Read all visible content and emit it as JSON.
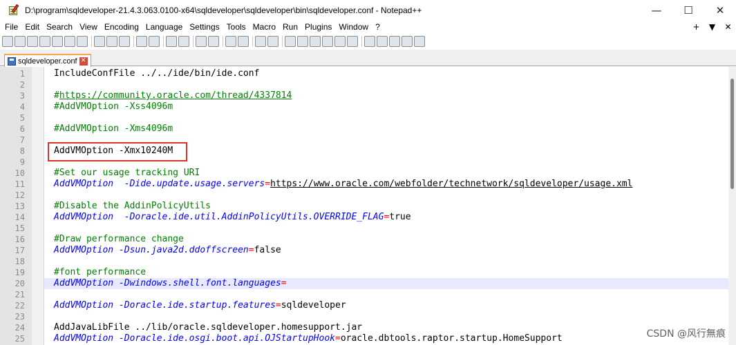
{
  "window": {
    "title": "D:\\program\\sqldeveloper-21.4.3.063.0100-x64\\sqldeveloper\\sqldeveloper\\bin\\sqldeveloper.conf - Notepad++",
    "minimize_glyph": "—",
    "maximize_glyph": "☐",
    "close_glyph": "✕"
  },
  "menu": {
    "items": [
      "File",
      "Edit",
      "Search",
      "View",
      "Encoding",
      "Language",
      "Settings",
      "Tools",
      "Macro",
      "Run",
      "Plugins",
      "Window",
      "?"
    ],
    "right": [
      "+",
      "▼",
      "✕"
    ]
  },
  "toolbar": {
    "buttons": [
      "new-file-icon",
      "open-file-icon",
      "save-icon",
      "save-all-icon",
      "close-icon",
      "close-all-icon",
      "print-icon",
      "|",
      "cut-icon",
      "copy-icon",
      "paste-icon",
      "|",
      "undo-icon",
      "redo-icon",
      "|",
      "find-icon",
      "replace-icon",
      "|",
      "zoom-in-icon",
      "zoom-out-icon",
      "|",
      "sync-vertical-icon",
      "sync-horizontal-icon",
      "|",
      "word-wrap-icon",
      "show-all-chars-icon",
      "|",
      "indent-guide-icon",
      "udl-icon",
      "doc-map-icon",
      "function-list-icon",
      "folder-workspace-icon",
      "monitor-icon",
      "|",
      "record-macro-icon",
      "stop-record-icon",
      "play-macro-icon",
      "run-multiple-icon",
      "save-macro-icon"
    ]
  },
  "tab": {
    "label": "sqldeveloper.conf"
  },
  "editor": {
    "current_line": 20,
    "lines": [
      {
        "n": "1",
        "tokens": [
          {
            "t": "IncludeConfFile ../../ide/bin/ide.conf",
            "c": "key"
          }
        ]
      },
      {
        "n": "2",
        "tokens": []
      },
      {
        "n": "3",
        "tokens": [
          {
            "t": "#",
            "c": "comment"
          },
          {
            "t": "https://community.oracle.com/thread/4337814",
            "c": "link"
          }
        ]
      },
      {
        "n": "4",
        "tokens": [
          {
            "t": "#AddVMOption -Xss4096m",
            "c": "comment"
          }
        ]
      },
      {
        "n": "5",
        "tokens": []
      },
      {
        "n": "6",
        "tokens": [
          {
            "t": "#AddVMOption -Xms4096m",
            "c": "comment"
          }
        ]
      },
      {
        "n": "7",
        "tokens": []
      },
      {
        "n": "8",
        "tokens": [
          {
            "t": "AddVMOption -Xmx10240M",
            "c": "key"
          }
        ]
      },
      {
        "n": "9",
        "tokens": []
      },
      {
        "n": "10",
        "tokens": [
          {
            "t": "#Set our usage tracking URI",
            "c": "comment"
          }
        ]
      },
      {
        "n": "11",
        "tokens": [
          {
            "t": "AddVMOption  -Dide.update.usage.servers",
            "c": "italic"
          },
          {
            "t": "=",
            "c": "op"
          },
          {
            "t": "https://www.oracle.com/webfolder/technetwork/sqldeveloper/usage.xml",
            "c": "url"
          }
        ]
      },
      {
        "n": "12",
        "tokens": []
      },
      {
        "n": "13",
        "tokens": [
          {
            "t": "#Disable the AddinPolicyUtils",
            "c": "comment"
          }
        ]
      },
      {
        "n": "14",
        "tokens": [
          {
            "t": "AddVMOption  -Doracle.ide.util.AddinPolicyUtils.OVERRIDE_FLAG",
            "c": "italic"
          },
          {
            "t": "=",
            "c": "op"
          },
          {
            "t": "true",
            "c": "val"
          }
        ]
      },
      {
        "n": "15",
        "tokens": []
      },
      {
        "n": "16",
        "tokens": [
          {
            "t": "#Draw performance change",
            "c": "comment"
          }
        ]
      },
      {
        "n": "17",
        "tokens": [
          {
            "t": "AddVMOption -Dsun.java2d.ddoffscreen",
            "c": "italic"
          },
          {
            "t": "=",
            "c": "op"
          },
          {
            "t": "false",
            "c": "val"
          }
        ]
      },
      {
        "n": "18",
        "tokens": []
      },
      {
        "n": "19",
        "tokens": [
          {
            "t": "#font performance",
            "c": "comment"
          }
        ]
      },
      {
        "n": "20",
        "tokens": [
          {
            "t": "AddVMOption -Dwindows.shell.font.languages",
            "c": "italic"
          },
          {
            "t": "=",
            "c": "op"
          }
        ]
      },
      {
        "n": "21",
        "tokens": []
      },
      {
        "n": "22",
        "tokens": [
          {
            "t": "AddVMOption -Doracle.ide.startup.features",
            "c": "italic"
          },
          {
            "t": "=",
            "c": "op"
          },
          {
            "t": "sqldeveloper",
            "c": "val"
          }
        ]
      },
      {
        "n": "23",
        "tokens": []
      },
      {
        "n": "24",
        "tokens": [
          {
            "t": "AddJavaLibFile ../lib/oracle.sqldeveloper.homesupport.jar",
            "c": "key"
          }
        ]
      },
      {
        "n": "25",
        "tokens": [
          {
            "t": "AddVMOption -Doracle.ide.osgi.boot.api.OJStartupHook",
            "c": "italic"
          },
          {
            "t": "=",
            "c": "op"
          },
          {
            "t": "oracle.dbtools.raptor.startup.HomeSupport",
            "c": "val"
          }
        ]
      }
    ]
  },
  "watermark": "CSDN @风行無痕",
  "colors": {
    "comment": "#008000",
    "italic_keyword": "#0000ff",
    "operator": "#ff0000",
    "highlight_box": "#e0302a",
    "current_line": "#e8e8ff"
  }
}
